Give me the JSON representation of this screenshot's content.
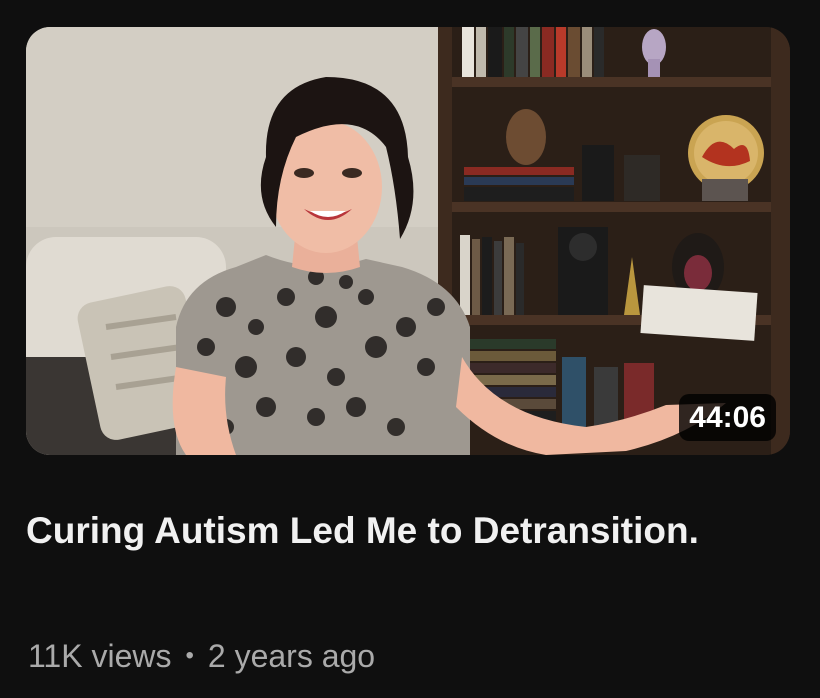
{
  "video": {
    "duration": "44:06",
    "title": "Curing Autism Led Me to Detransition.",
    "views": "11K views",
    "separator": "•",
    "age": "2 years ago"
  },
  "colors": {
    "background": "#0f0f0f",
    "title": "#f1f1f1",
    "meta": "#aaaaaa"
  }
}
